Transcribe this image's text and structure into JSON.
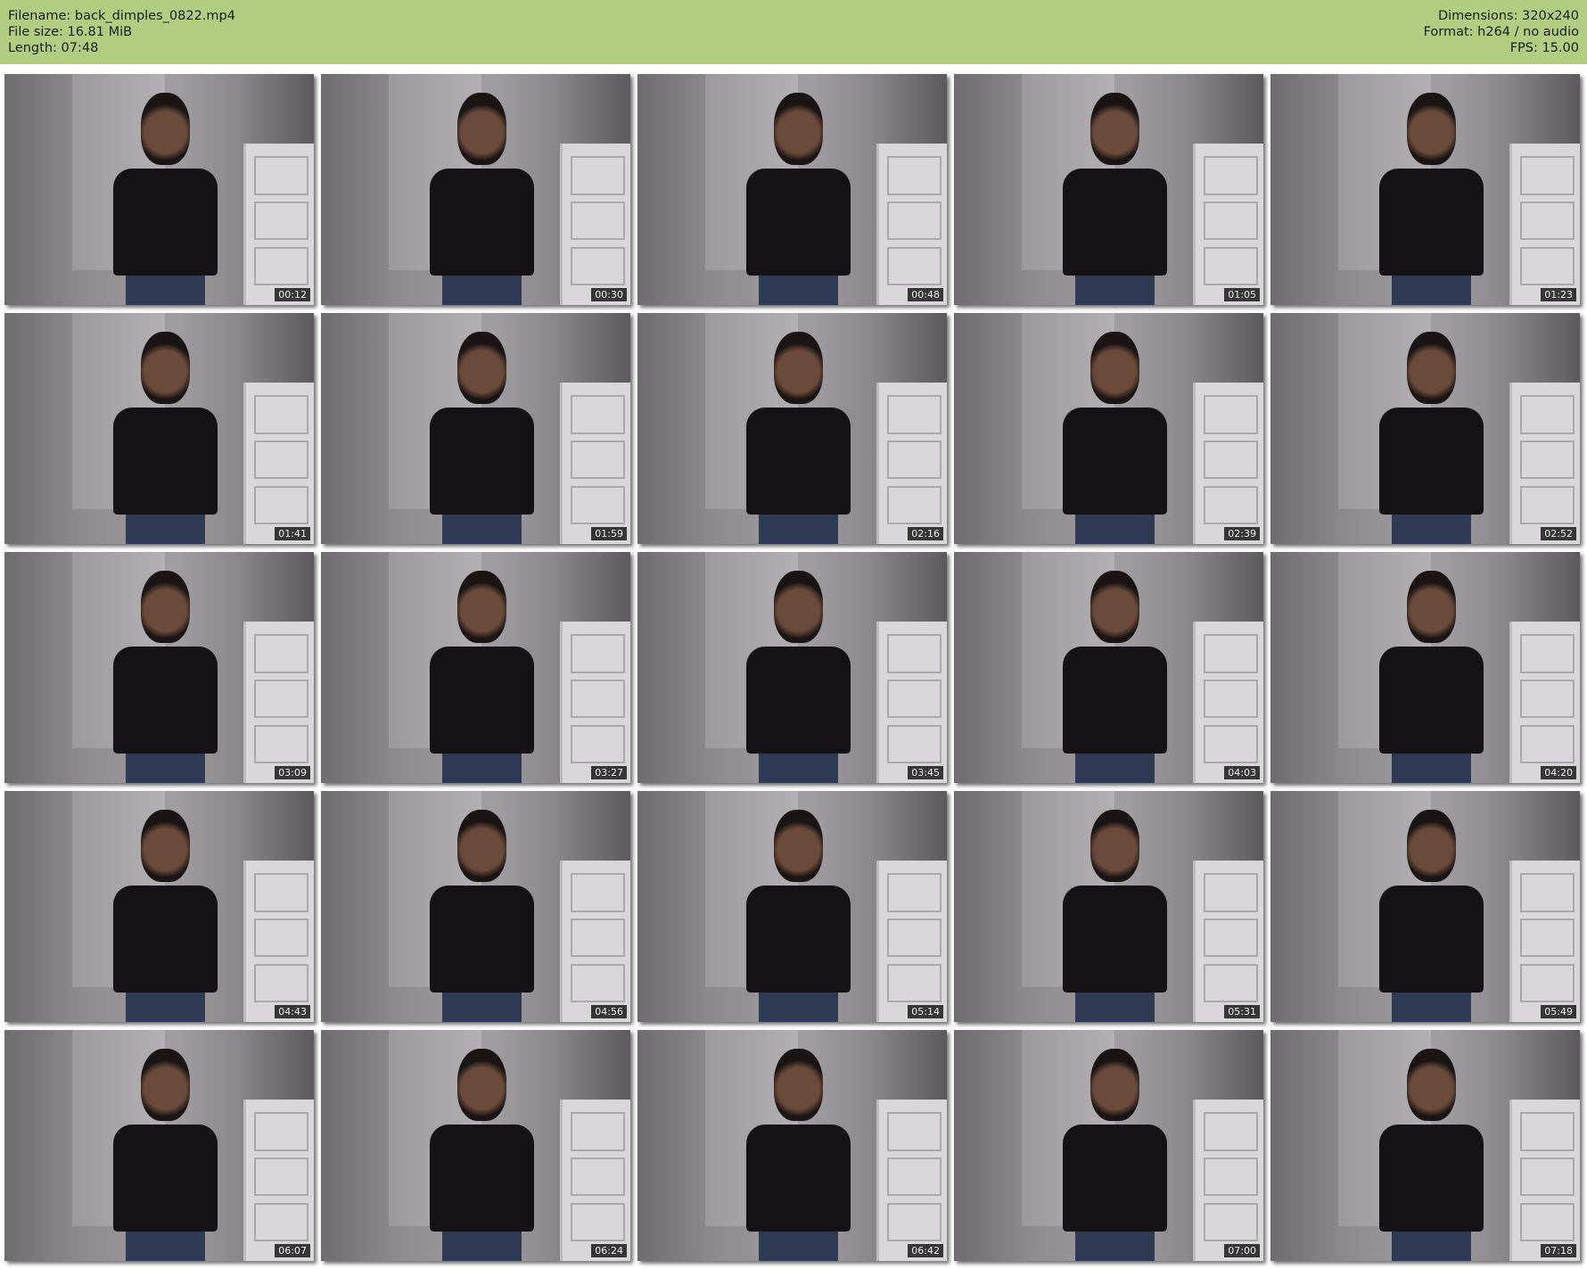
{
  "header": {
    "filename": "Filename: back_dimples_0822.mp4",
    "filesize": "File size: 16.81 MiB",
    "length": "Length: 07:48",
    "dimensions": "Dimensions: 320x240",
    "format": "Format: h264 / no audio",
    "fps": "FPS: 15.00"
  },
  "thumbnails": [
    "00:12",
    "00:30",
    "00:48",
    "01:05",
    "01:23",
    "01:41",
    "01:59",
    "02:16",
    "02:39",
    "02:52",
    "03:09",
    "03:27",
    "03:45",
    "04:03",
    "04:20",
    "04:43",
    "04:56",
    "05:14",
    "05:31",
    "05:49",
    "06:07",
    "06:24",
    "06:42",
    "07:00",
    "07:18"
  ]
}
